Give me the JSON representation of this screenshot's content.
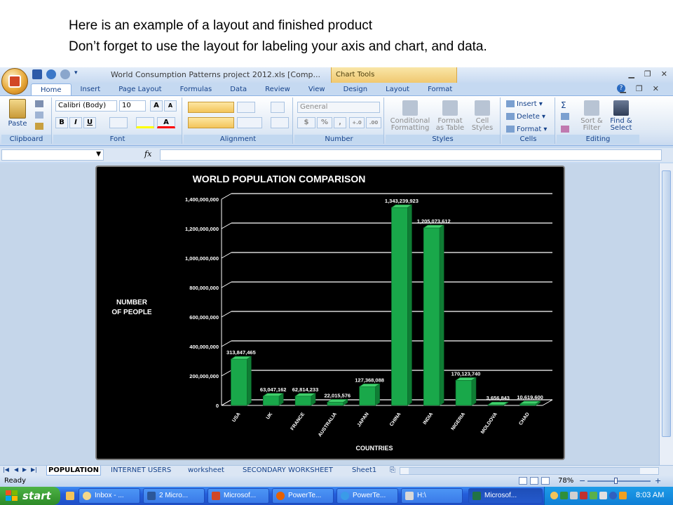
{
  "caption": {
    "line1": "Here is an example of a layout and finished product",
    "line2": "Don’t forget to use the layout for labeling your axis and chart, and data."
  },
  "window": {
    "title": "World Consumption Patterns project 2012.xls [Comp...",
    "context_tab": "Chart Tools"
  },
  "ribbon": {
    "tabs": [
      "Home",
      "Insert",
      "Page Layout",
      "Formulas",
      "Data",
      "Review",
      "View",
      "Design",
      "Layout",
      "Format"
    ],
    "active_tab": "Home",
    "clipboard": {
      "paste": "Paste",
      "label": "Clipboard"
    },
    "font": {
      "name": "Calibri (Body)",
      "size": "10",
      "label": "Font",
      "bold": "B",
      "italic": "I",
      "underline": "U",
      "grow": "A",
      "shrink": "A",
      "color": "A"
    },
    "alignment": {
      "label": "Alignment"
    },
    "number": {
      "format": "General",
      "currency": "$",
      "percent": "%",
      "comma": ",",
      "inc_dec": "+.0",
      "dec_dec": ".00",
      "label": "Number"
    },
    "styles": {
      "conditional": "Conditional",
      "formatting": "Formatting",
      "format_as": "Format",
      "as_table": "as Table",
      "cell": "Cell",
      "cell_styles": "Styles",
      "label": "Styles"
    },
    "cells": {
      "insert": "Insert",
      "delete": "Delete",
      "format": "Format",
      "label": "Cells"
    },
    "editing": {
      "sigma": "Σ",
      "sort": "Sort &",
      "filter": "Filter",
      "find": "Find &",
      "select": "Select",
      "label": "Editing"
    }
  },
  "formula_bar": {
    "fx": "fx"
  },
  "sheets": {
    "tabs": [
      "POPULATION",
      "INTERNET USERS",
      "worksheet",
      "SECONDARY WORKSHEET",
      "Sheet1"
    ],
    "active": "POPULATION"
  },
  "status": {
    "ready": "Ready",
    "zoom": "78%",
    "minus": "−",
    "plus": "+"
  },
  "taskbar": {
    "start": "start",
    "tasks": [
      "Inbox - ...",
      "2 Micro...",
      "Microsof...",
      "PowerTe...",
      "PowerTe...",
      "H:\\",
      "Microsof..."
    ],
    "active_task": "Microsof...",
    "clock": "8:03 AM"
  },
  "colors": {
    "bar_green": "#19a84a",
    "chart_bg": "#000000",
    "excel_blue": "#c5d9f1"
  },
  "chart_data": {
    "type": "bar",
    "title": "WORLD POPULATION COMPARISON",
    "xlabel": "COUNTRIES",
    "ylabel": "NUMBER OF PEOPLE",
    "ylabel_lines": [
      "NUMBER",
      "OF PEOPLE"
    ],
    "categories": [
      "USA",
      "UK",
      "FRANCE",
      "AUSTRALIA",
      "JAPAN",
      "CHINA",
      "INDIA",
      "NIGERIA",
      "MOLDOVA",
      "CHAD"
    ],
    "values": [
      313847465,
      63047162,
      62814233,
      22015576,
      127368088,
      1343239923,
      1205073612,
      170123740,
      3656843,
      10619600
    ],
    "data_labels": [
      "313,847,465",
      "63,047,162",
      "62,814,233",
      "22,015,576",
      "127,368,088",
      "1,343,239,923",
      "1,205,073,612",
      "170,123,740",
      "3,656,843",
      "10,619,600"
    ],
    "yticks": [
      "0",
      "200,000,000",
      "400,000,000",
      "600,000,000",
      "800,000,000",
      "1,000,000,000",
      "1,200,000,000",
      "1,400,000,000"
    ],
    "ylim": [
      0,
      1400000000
    ],
    "grid": true,
    "legend": "none",
    "style": "3d-column"
  }
}
